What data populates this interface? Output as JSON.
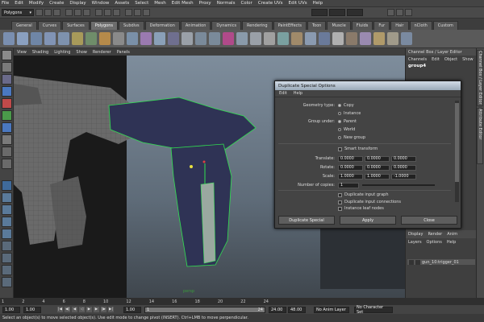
{
  "menubar": [
    "File",
    "Edit",
    "Modify",
    "Create",
    "Display",
    "Window",
    "Assets",
    "Select",
    "Mesh",
    "Edit Mesh",
    "Proxy",
    "Normals",
    "Color",
    "Create UVs",
    "Edit UVs",
    "Help"
  ],
  "statusline": {
    "mode": "Polygons"
  },
  "shelf_tabs": [
    "General",
    "Curves",
    "Surfaces",
    "Polygons",
    "Subdivs",
    "Deformation",
    "Animation",
    "Dynamics",
    "Rendering",
    "PaintEffects",
    "Toon",
    "Muscle",
    "Fluids",
    "Fur",
    "Hair",
    "nCloth",
    "Custom"
  ],
  "viewport_menu": [
    "View",
    "Shading",
    "Lighting",
    "Show",
    "Renderer",
    "Panels"
  ],
  "viewport_label": "persp",
  "channel_box": {
    "title": "Channel Box / Layer Editor",
    "menu": [
      "Channels",
      "Edit",
      "Object",
      "Show"
    ],
    "object": "group4",
    "layer_tabs": [
      "Display",
      "Render",
      "Anim"
    ],
    "layer_menu": [
      "Layers",
      "Options",
      "Help"
    ],
    "layer_name": "gun_10:trigger_01"
  },
  "attribute_strip": [
    "Channel Box / Layer Editor",
    "Attribute Editor"
  ],
  "dialog": {
    "title": "Duplicate Special Options",
    "menu": [
      "Edit",
      "Help"
    ],
    "geometry_type_label": "Geometry type:",
    "geometry_options": [
      "Copy",
      "Instance"
    ],
    "group_under_label": "Group under:",
    "group_options": [
      "Parent",
      "World",
      "New group"
    ],
    "smart_transform": "Smart transform",
    "translate_label": "Translate:",
    "translate": [
      "0.0000",
      "0.0000",
      "0.0000"
    ],
    "rotate_label": "Rotate:",
    "rotate": [
      "0.0000",
      "0.0000",
      "0.0000"
    ],
    "scale_label": "Scale:",
    "scale": [
      "1.0000",
      "1.0000",
      "-1.0000"
    ],
    "copies_label": "Number of copies:",
    "copies": "1",
    "checks": [
      "Duplicate input graph",
      "Duplicate input connections",
      "Instance leaf nodes"
    ],
    "buttons": [
      "Duplicate Special",
      "Apply",
      "Close"
    ]
  },
  "timeline_ticks": [
    "1",
    "2",
    "4",
    "6",
    "8",
    "10",
    "12",
    "14",
    "16",
    "18",
    "20",
    "22",
    "24"
  ],
  "range": {
    "start": "1.00",
    "current": "1.00",
    "range_start": "1.00",
    "handle": "1",
    "range_end": "24",
    "end": "24.00",
    "end2": "48.00",
    "anim_layer": "No Anim Layer",
    "char_set": "No Character Set"
  },
  "help_line": "Select an object(s) to move selected object(s). Use edit mode to change pivot (INSERT). Ctrl+LMB to move perpendicular."
}
